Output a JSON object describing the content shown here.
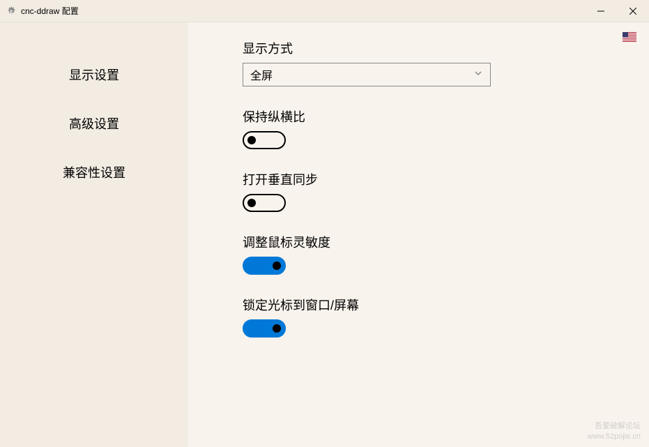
{
  "titlebar": {
    "title": "cnc-ddraw 配置"
  },
  "sidebar": {
    "items": [
      {
        "label": "显示设置"
      },
      {
        "label": "高级设置"
      },
      {
        "label": "兼容性设置"
      }
    ]
  },
  "main": {
    "display_mode": {
      "label": "显示方式",
      "value": "全屏"
    },
    "aspect_ratio": {
      "label": "保持纵横比",
      "on": false
    },
    "vsync": {
      "label": "打开垂直同步",
      "on": false
    },
    "mouse_sensitivity": {
      "label": "调整鼠标灵敏度",
      "on": true
    },
    "lock_cursor": {
      "label": "锁定光标到窗口/屏幕",
      "on": true
    }
  },
  "watermark": {
    "line1": "吾爱破解论坛",
    "line2": "www.52pojie.cn"
  }
}
